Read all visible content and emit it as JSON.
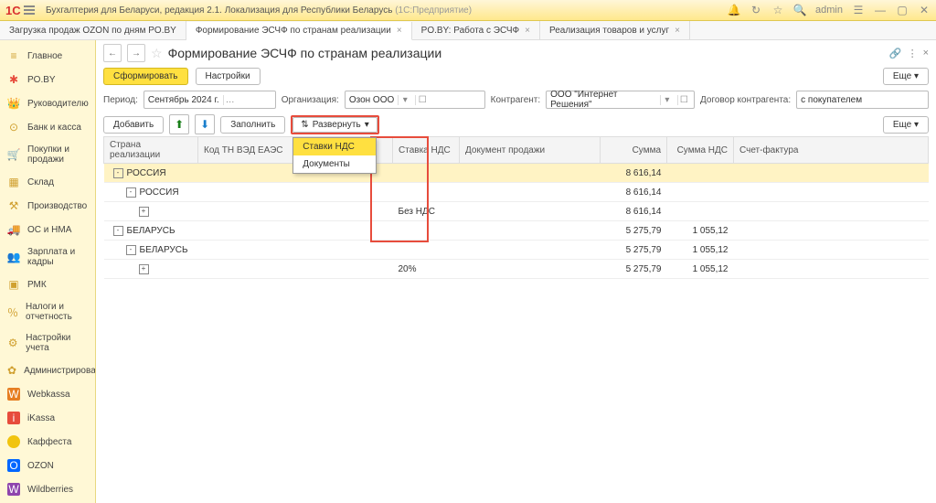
{
  "app": {
    "title": "Бухгалтерия для Беларуси, редакция 2.1. Локализация для Республики Беларусь",
    "subtitle": "(1С:Предприятие)",
    "user": "admin"
  },
  "tabs": [
    {
      "label": "Загрузка продаж OZON по дням PO.BY",
      "active": false
    },
    {
      "label": "Формирование ЭСЧФ по странам реализации",
      "active": true
    },
    {
      "label": "PO.BY: Работа с ЭСЧФ",
      "active": false
    },
    {
      "label": "Реализация товаров и услуг",
      "active": false
    }
  ],
  "sidebar": [
    {
      "icon": "≡",
      "label": "Главное"
    },
    {
      "icon": "*",
      "label": "PO.BY"
    },
    {
      "icon": "👤",
      "label": "Руководителю"
    },
    {
      "icon": "💰",
      "label": "Банк и касса"
    },
    {
      "icon": "🛒",
      "label": "Покупки и продажи"
    },
    {
      "icon": "▦",
      "label": "Склад"
    },
    {
      "icon": "🏭",
      "label": "Производство"
    },
    {
      "icon": "🚚",
      "label": "ОС и НМА"
    },
    {
      "icon": "👥",
      "label": "Зарплата и кадры"
    },
    {
      "icon": "▣",
      "label": "РМК"
    },
    {
      "icon": "%",
      "label": "Налоги и отчетность"
    },
    {
      "icon": "⚙",
      "label": "Настройки учета"
    },
    {
      "icon": "✿",
      "label": "Администрирование"
    },
    {
      "icon": "W",
      "label": "Webkassa"
    },
    {
      "icon": "i",
      "label": "iKassa"
    },
    {
      "icon": "●",
      "label": "Каффеста"
    },
    {
      "icon": "O",
      "label": "OZON"
    },
    {
      "icon": "W",
      "label": "Wildberries"
    }
  ],
  "page": {
    "title": "Формирование ЭСЧФ по странам реализации"
  },
  "toolbar": {
    "generate": "Сформировать",
    "settings": "Настройки",
    "more": "Еще"
  },
  "filters": {
    "period_label": "Период:",
    "period_value": "Сентябрь 2024 г.",
    "org_label": "Организация:",
    "org_value": "Озон ООО",
    "contr_label": "Контрагент:",
    "contr_value": "ООО \"Интернет Решения\"",
    "dog_label": "Договор контрагента:",
    "dog_value": "с покупателем"
  },
  "toolbar2": {
    "add": "Добавить",
    "fill": "Заполнить",
    "expand": "Развернуть",
    "more": "Еще"
  },
  "expand_menu": {
    "item1": "Ставки НДС",
    "item2": "Документы"
  },
  "columns": {
    "country": "Страна реализации",
    "code": "Код ТН ВЭД ЕАЭС",
    "rate": "Ставка НДС",
    "doc": "Документ продажи",
    "sum": "Сумма",
    "sumvat": "Сумма НДС",
    "invoice": "Счет-фактура"
  },
  "rows": [
    {
      "level": 0,
      "expand": "-",
      "country": "РОССИЯ",
      "rate": "",
      "sum": "8 616,14",
      "sumvat": "",
      "sel": true
    },
    {
      "level": 1,
      "expand": "-",
      "country": "РОССИЯ",
      "rate": "",
      "sum": "8 616,14",
      "sumvat": ""
    },
    {
      "level": 2,
      "expand": "+",
      "country": "",
      "rate": "Без НДС",
      "sum": "8 616,14",
      "sumvat": ""
    },
    {
      "level": 0,
      "expand": "-",
      "country": "БЕЛАРУСЬ",
      "rate": "",
      "sum": "5 275,79",
      "sumvat": "1 055,12"
    },
    {
      "level": 1,
      "expand": "-",
      "country": "БЕЛАРУСЬ",
      "rate": "",
      "sum": "5 275,79",
      "sumvat": "1 055,12"
    },
    {
      "level": 2,
      "expand": "+",
      "country": "",
      "rate": "20%",
      "sum": "5 275,79",
      "sumvat": "1 055,12"
    }
  ]
}
